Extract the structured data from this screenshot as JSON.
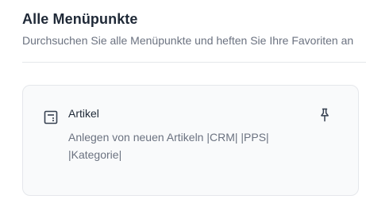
{
  "header": {
    "title": "Alle Menüpunkte",
    "subtitle": "Durchsuchen Sie alle Menüpunkte und heften Sie Ihre Favoriten an"
  },
  "menu_items": [
    {
      "icon": "calculator-icon",
      "title": "Artikel",
      "description": "Anlegen von neuen Artikeln |CRM| |PPS| |Kategorie|",
      "pin_icon": "pin-icon"
    }
  ]
}
